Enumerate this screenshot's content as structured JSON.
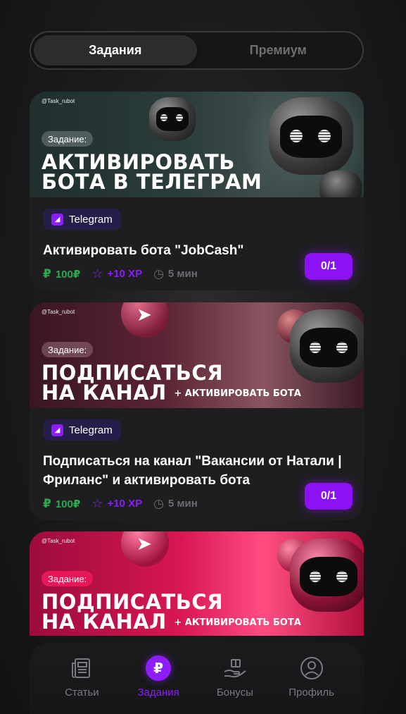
{
  "tabs": [
    {
      "label": "Задания",
      "active": true
    },
    {
      "label": "Премиум",
      "active": false
    }
  ],
  "cards": [
    {
      "banner": {
        "handle": "@Task_rubot",
        "label": "Задание:",
        "headline_line1": "АКТИВИРОВАТЬ",
        "headline_line2": "БОТА В ТЕЛЕГРАМ",
        "theme": "#1d2b2a"
      },
      "tag": "Telegram",
      "title": "Активировать бота \"JobCash\"",
      "reward": "100₽",
      "xp": "+10 XP",
      "time": "5 мин",
      "progress": "0/1"
    },
    {
      "banner": {
        "handle": "@Task_rubot",
        "label": "Задание:",
        "headline_line1": "ПОДПИСАТЬСЯ",
        "headline_line2": "НА КАНАЛ",
        "headline_extra": "+ АКТИВИРОВАТЬ БОТА",
        "theme": "#4a1a2c"
      },
      "tag": "Telegram",
      "title": "Подписаться на канал \"Вакансии от Натали | Фриланс\" и активировать бота",
      "reward": "100₽",
      "xp": "+10 XP",
      "time": "5 мин",
      "progress": "0/1"
    },
    {
      "banner": {
        "handle": "@Task_rubot",
        "label": "Задание:",
        "headline_line1": "ПОДПИСАТЬСЯ",
        "headline_line2": "НА КАНАЛ",
        "headline_extra": "+ АКТИВИРОВАТЬ БОТА",
        "theme": "#c4104a"
      }
    }
  ],
  "nav": [
    {
      "label": "Статьи",
      "icon": "newspaper-icon",
      "active": false
    },
    {
      "label": "Задания",
      "icon": "ruble-coin-icon",
      "active": true
    },
    {
      "label": "Бонусы",
      "icon": "gift-hand-icon",
      "active": false
    },
    {
      "label": "Профиль",
      "icon": "profile-icon",
      "active": false
    }
  ],
  "colors": {
    "accent": "#8c12f5",
    "reward": "#2fa84f",
    "xp": "#8a1cff"
  }
}
